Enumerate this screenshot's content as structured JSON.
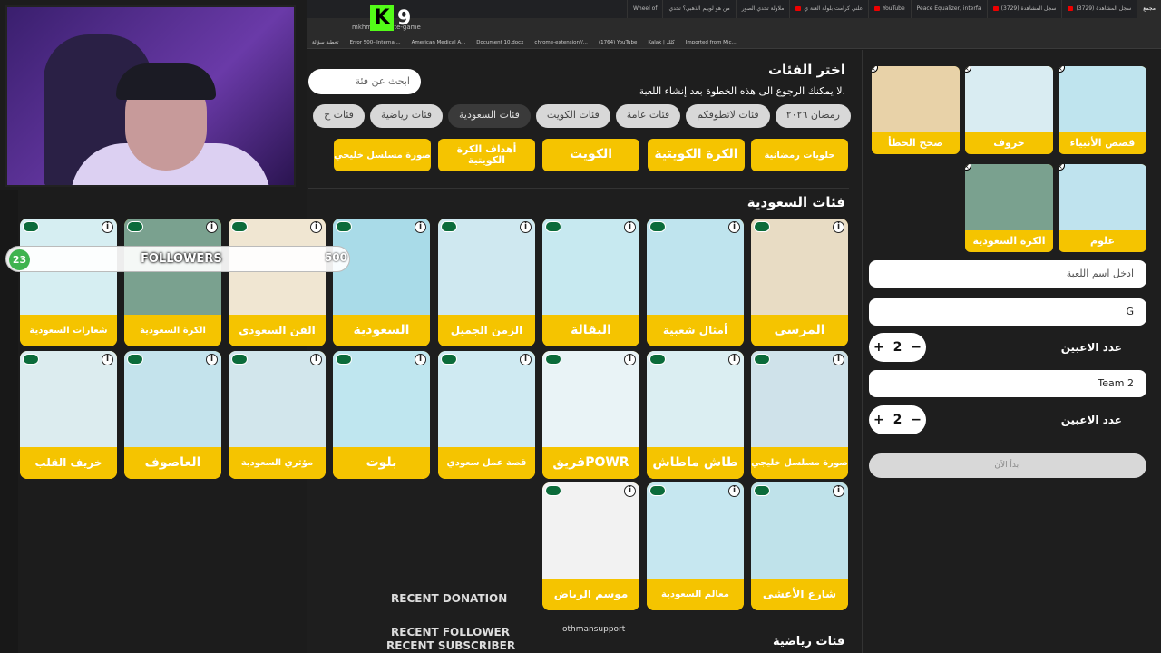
{
  "browser": {
    "tabs": [
      {
        "label": "مجمع",
        "active": true
      },
      {
        "label": "(3729) سجل المشاهدة",
        "yt": true
      },
      {
        "label": "(3729) سجل المشاهدة",
        "yt": true
      },
      {
        "label": "Peace Equalizer, interfa",
        "yt": false
      },
      {
        "label": "YouTube",
        "yt": true
      },
      {
        "label": "علني كرامت بلولة العنة ي",
        "yt": true
      },
      {
        "label": "ملاولة تحدي الصور",
        "yt": false
      },
      {
        "label": "من هو لوييم الذهبي؟ تحدي",
        "yt": false
      },
      {
        "label": "Wheel of",
        "yt": false
      }
    ],
    "address": "mkhm.../create-game",
    "bookmarks": [
      "تخطية سؤالة",
      "Error 500--Internal...",
      "American Medical A...",
      "Document 10.docx",
      "chrome-extension//...",
      "(1764) YouTube",
      "Kalak | كلك",
      "Imported from Mic..."
    ]
  },
  "overlay": {
    "kick_letter": "K",
    "kick_number": "9",
    "followers": {
      "current": "23",
      "label": "FOLLOWERS",
      "goal": "500"
    },
    "recent_donation": "RECENT DONATION",
    "recent_follower": "RECENT FOLLOWER",
    "recent_follower_name": "othmansupport",
    "recent_subscriber": "RECENT SUBSCRIBER"
  },
  "main": {
    "title": "اختر الفئات",
    "subtitle": "لا يمكنك الرجوع الى هذه الخطوة بعد إنشاء اللعبة.",
    "search_placeholder": "ابحث عن فئة",
    "category_tabs": [
      {
        "label": "رمضان ٢٠٢٦",
        "active": false
      },
      {
        "label": "فئات لاتطوفكم",
        "active": false
      },
      {
        "label": "فئات عامة",
        "active": false
      },
      {
        "label": "فئات الكويت",
        "active": false
      },
      {
        "label": "فئات السعودية",
        "active": true
      },
      {
        "label": "فئات رياضية",
        "active": false
      },
      {
        "label": "فئات ح",
        "active": false
      }
    ],
    "top_row": [
      "حلويات رمضانية",
      "الكرة الكويتية",
      "الكويت",
      "أهداف الكرة الكويتية",
      "صورة مسلسل خليجي"
    ],
    "saudi_title": "فئات السعودية",
    "saudi_cards": [
      {
        "label": "المرسى",
        "bg": "#e8dcc4"
      },
      {
        "label": "أمثال شعبية",
        "bg": "#bfe4ee"
      },
      {
        "label": "البقالة",
        "bg": "#c7e9f0"
      },
      {
        "label": "الزمن الجميل",
        "bg": "#cfe8f0"
      },
      {
        "label": "السعودية",
        "bg": "#a9dbe8"
      },
      {
        "label": "الفن السعودي",
        "bg": "#f0e6d2"
      },
      {
        "label": "الكرة السعودية",
        "bg": "#7aa18f"
      },
      {
        "label": "شعارات السعودية",
        "bg": "#d6eef2"
      },
      {
        "label": "صورة مسلسل خليجي",
        "bg": "#cfe2ea"
      },
      {
        "label": "طاش ماطاش",
        "bg": "#dbeef2"
      },
      {
        "label": "فريقPOWR",
        "bg": "#e9f3f6"
      },
      {
        "label": "قصة عمل سعودي",
        "bg": "#cfeaf2"
      },
      {
        "label": "بلوت",
        "bg": "#bfe6ef"
      },
      {
        "label": "مؤثري السعودية",
        "bg": "#d2e6ec"
      },
      {
        "label": "العاصوف",
        "bg": "#c4e3ec"
      },
      {
        "label": "خريف القلب",
        "bg": "#dcecef"
      },
      {
        "label": "شارع الأعشى",
        "bg": "#bfe2ea"
      },
      {
        "label": "معالم السعودية",
        "bg": "#c6e7f0"
      },
      {
        "label": "موسم الرياض",
        "bg": "#f2f2f2"
      }
    ],
    "next_title": "فئات رياضية"
  },
  "sidebar": {
    "selected": [
      {
        "label": "قصص الأنبياء",
        "bg": "#bfe4ee"
      },
      {
        "label": "حروف",
        "bg": "#d9ecf2"
      },
      {
        "label": "صحح الخطأ",
        "bg": "#e8d2a8"
      },
      {
        "label": "علوم",
        "bg": "#bfe3ee"
      },
      {
        "label": "الكرة السعودية",
        "bg": "#7aa18f"
      }
    ],
    "game_name_placeholder": "ادخل اسم اللعبة",
    "team1_value": "G",
    "players_label": "عدد الاعبين",
    "team1_players": "2",
    "team2_value": "Team 2",
    "team2_players": "2",
    "start_label": "ابدأ الآن"
  },
  "colors": {
    "accent": "#f5c400",
    "background": "#1c1c1c",
    "kick": "#53fc18"
  }
}
